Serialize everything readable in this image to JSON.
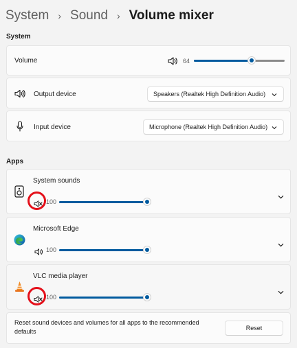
{
  "breadcrumb": {
    "root": "System",
    "parent": "Sound",
    "current": "Volume mixer"
  },
  "system_section": {
    "heading": "System",
    "volume": {
      "label": "Volume",
      "value": "64",
      "level": 0.64
    },
    "output": {
      "label": "Output device",
      "selected": "Speakers (Realtek High Definition Audio)"
    },
    "input": {
      "label": "Input device",
      "selected": "Microphone (Realtek High Definition Audio)"
    }
  },
  "apps_section": {
    "heading": "Apps",
    "apps": [
      {
        "name": "System sounds",
        "volume": "100",
        "level": 1.0,
        "muted": true,
        "icon": "speaker-device-icon"
      },
      {
        "name": "Microsoft Edge",
        "volume": "100",
        "level": 1.0,
        "muted": false,
        "icon": "edge-logo-icon"
      },
      {
        "name": "VLC media player",
        "volume": "100",
        "level": 1.0,
        "muted": true,
        "icon": "vlc-cone-icon"
      }
    ]
  },
  "reset": {
    "text": "Reset sound devices and volumes for all apps to the recommended defaults",
    "button": "Reset"
  },
  "colors": {
    "accent": "#005a9e",
    "highlight_ring": "#e4101a",
    "background": "#f3f3f3"
  }
}
